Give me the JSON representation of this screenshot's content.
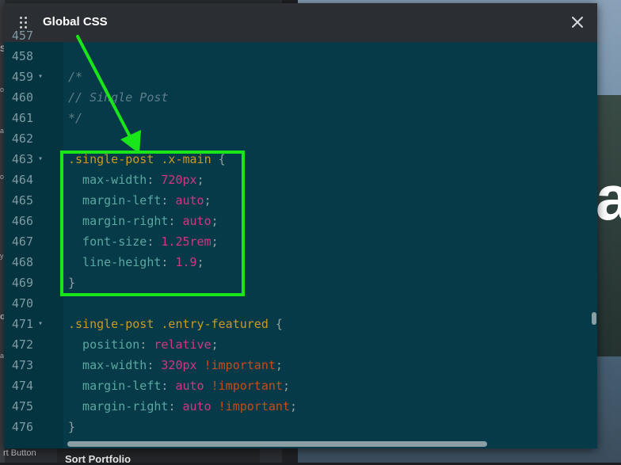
{
  "modal": {
    "title": "Global CSS",
    "close_icon": "close-icon",
    "drag_icon": "drag-handle-icon"
  },
  "background": {
    "bottom_left_label": "rt Button",
    "bottom_panel_label": "Sort Portfolio",
    "big_letter": "a",
    "side_letters": [
      "S",
      "o",
      "a",
      "ol",
      "y",
      "o",
      "a"
    ]
  },
  "annotation": {
    "arrow_color": "#19e619",
    "box_color": "#19e619"
  },
  "editor": {
    "lines": [
      {
        "n": "457",
        "tokens": []
      },
      {
        "n": "458",
        "tokens": []
      },
      {
        "n": "459",
        "fold": true,
        "tokens": [
          {
            "t": "/*",
            "c": "c-comment"
          }
        ]
      },
      {
        "n": "460",
        "tokens": [
          {
            "t": "// Single Post",
            "c": "c-comment"
          }
        ]
      },
      {
        "n": "461",
        "tokens": [
          {
            "t": "*/",
            "c": "c-comment"
          }
        ]
      },
      {
        "n": "462",
        "tokens": []
      },
      {
        "n": "463",
        "fold": true,
        "tokens": [
          {
            "t": ".single-post .x-main",
            "c": "c-sel"
          },
          {
            "t": " {",
            "c": "c-punc"
          }
        ]
      },
      {
        "n": "464",
        "tokens": [
          {
            "t": "  max-width",
            "c": "c-prop"
          },
          {
            "t": ": ",
            "c": "c-punc"
          },
          {
            "t": "720px",
            "c": "c-val"
          },
          {
            "t": ";",
            "c": "c-punc"
          }
        ]
      },
      {
        "n": "465",
        "tokens": [
          {
            "t": "  margin-left",
            "c": "c-prop"
          },
          {
            "t": ": ",
            "c": "c-punc"
          },
          {
            "t": "auto",
            "c": "c-val"
          },
          {
            "t": ";",
            "c": "c-punc"
          }
        ]
      },
      {
        "n": "466",
        "tokens": [
          {
            "t": "  margin-right",
            "c": "c-prop"
          },
          {
            "t": ": ",
            "c": "c-punc"
          },
          {
            "t": "auto",
            "c": "c-val"
          },
          {
            "t": ";",
            "c": "c-punc"
          }
        ]
      },
      {
        "n": "467",
        "tokens": [
          {
            "t": "  font-size",
            "c": "c-prop"
          },
          {
            "t": ": ",
            "c": "c-punc"
          },
          {
            "t": "1.25rem",
            "c": "c-val"
          },
          {
            "t": ";",
            "c": "c-punc"
          }
        ]
      },
      {
        "n": "468",
        "tokens": [
          {
            "t": "  line-height",
            "c": "c-prop"
          },
          {
            "t": ": ",
            "c": "c-punc"
          },
          {
            "t": "1.9",
            "c": "c-val"
          },
          {
            "t": ";",
            "c": "c-punc"
          }
        ]
      },
      {
        "n": "469",
        "tokens": [
          {
            "t": "}",
            "c": "c-punc"
          }
        ]
      },
      {
        "n": "470",
        "tokens": []
      },
      {
        "n": "471",
        "fold": true,
        "tokens": [
          {
            "t": ".single-post .entry-featured",
            "c": "c-sel"
          },
          {
            "t": " {",
            "c": "c-punc"
          }
        ]
      },
      {
        "n": "472",
        "tokens": [
          {
            "t": "  position",
            "c": "c-prop"
          },
          {
            "t": ": ",
            "c": "c-punc"
          },
          {
            "t": "relative",
            "c": "c-val"
          },
          {
            "t": ";",
            "c": "c-punc"
          }
        ]
      },
      {
        "n": "473",
        "tokens": [
          {
            "t": "  max-width",
            "c": "c-prop"
          },
          {
            "t": ": ",
            "c": "c-punc"
          },
          {
            "t": "320px",
            "c": "c-val"
          },
          {
            "t": " ",
            "c": "c-punc"
          },
          {
            "t": "!important",
            "c": "c-kw"
          },
          {
            "t": ";",
            "c": "c-punc"
          }
        ]
      },
      {
        "n": "474",
        "tokens": [
          {
            "t": "  margin-left",
            "c": "c-prop"
          },
          {
            "t": ": ",
            "c": "c-punc"
          },
          {
            "t": "auto",
            "c": "c-val"
          },
          {
            "t": " ",
            "c": "c-punc"
          },
          {
            "t": "!important",
            "c": "c-kw"
          },
          {
            "t": ";",
            "c": "c-punc"
          }
        ]
      },
      {
        "n": "475",
        "tokens": [
          {
            "t": "  margin-right",
            "c": "c-prop"
          },
          {
            "t": ": ",
            "c": "c-punc"
          },
          {
            "t": "auto",
            "c": "c-val"
          },
          {
            "t": " ",
            "c": "c-punc"
          },
          {
            "t": "!important",
            "c": "c-kw"
          },
          {
            "t": ";",
            "c": "c-punc"
          }
        ]
      },
      {
        "n": "476",
        "tokens": [
          {
            "t": "}",
            "c": "c-punc"
          }
        ]
      }
    ]
  }
}
